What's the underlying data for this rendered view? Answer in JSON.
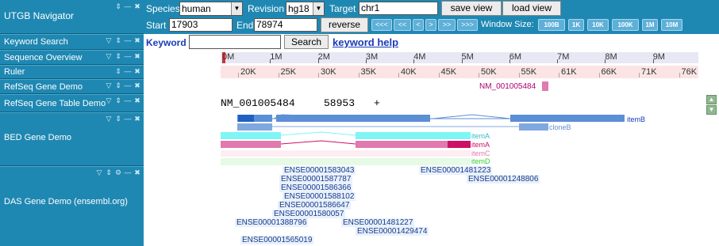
{
  "navigator": {
    "title": "UTGB Navigator"
  },
  "tracks": [
    {
      "label": "Keyword Search"
    },
    {
      "label": "Sequence Overview"
    },
    {
      "label": "Ruler"
    },
    {
      "label": "RefSeq Gene Demo"
    },
    {
      "label": "RefSeq Gene Table Demo"
    },
    {
      "label": "BED Gene Demo"
    },
    {
      "label": "DAS Gene Demo (ensembl.org)"
    }
  ],
  "controls": {
    "species_label": "Species",
    "species_value": "human",
    "revision_label": "Revision",
    "revision_value": "hg18",
    "target_label": "Target",
    "target_value": "chr1",
    "save_view": "save view",
    "load_view": "load view",
    "start_label": "Start",
    "start_value": "17903",
    "end_label": "End",
    "end_value": "78974",
    "reverse": "reverse",
    "nav": [
      "<<<",
      "<<",
      "<",
      ">",
      ">>",
      ">>>"
    ],
    "window_label": "Window Size:",
    "window_sizes": [
      "100B",
      "1K",
      "10K",
      "100K",
      "1M",
      "10M"
    ]
  },
  "keyword": {
    "label": "Keyword",
    "value": "",
    "search": "Search",
    "help": "keyword help"
  },
  "overview_ticks": [
    "0M",
    "1M",
    "2M",
    "3M",
    "4M",
    "5M",
    "6M",
    "7M",
    "8M",
    "9M"
  ],
  "ruler_ticks": [
    "20K",
    "25K",
    "30K",
    "35K",
    "40K",
    "45K",
    "50K",
    "55K",
    "61K",
    "66K",
    "71K",
    "76K"
  ],
  "refseq": {
    "gene": "NM_001005484"
  },
  "refseq_table": {
    "name": "NM_001005484",
    "position": "58953",
    "strand": "+"
  },
  "bed": {
    "itemB": "itemB",
    "cloneB": "cloneB",
    "itemA1": "itemA",
    "itemA2": "itemA",
    "itemC": "itemC",
    "itemD": "itemD"
  },
  "das": [
    "ENSE00001583043",
    "ENSE00001481223",
    "ENSE00001587787",
    "ENSE00001248806",
    "ENSE00001586366",
    "ENSE00001588102",
    "ENSE00001586647",
    "ENSE00001580057",
    "ENSE00001388796",
    "ENSE00001481227",
    "ENSE00001429474",
    "ENSE00001565019"
  ],
  "colors": {
    "panel": "#1f88b2",
    "link": "#1a3ab8",
    "blue_feature": "#5b8fd6",
    "cyan_feature": "#7ff5f5",
    "pink_feature": "#e07aaf",
    "magenta": "#cc1166",
    "green": "#33cc33"
  }
}
